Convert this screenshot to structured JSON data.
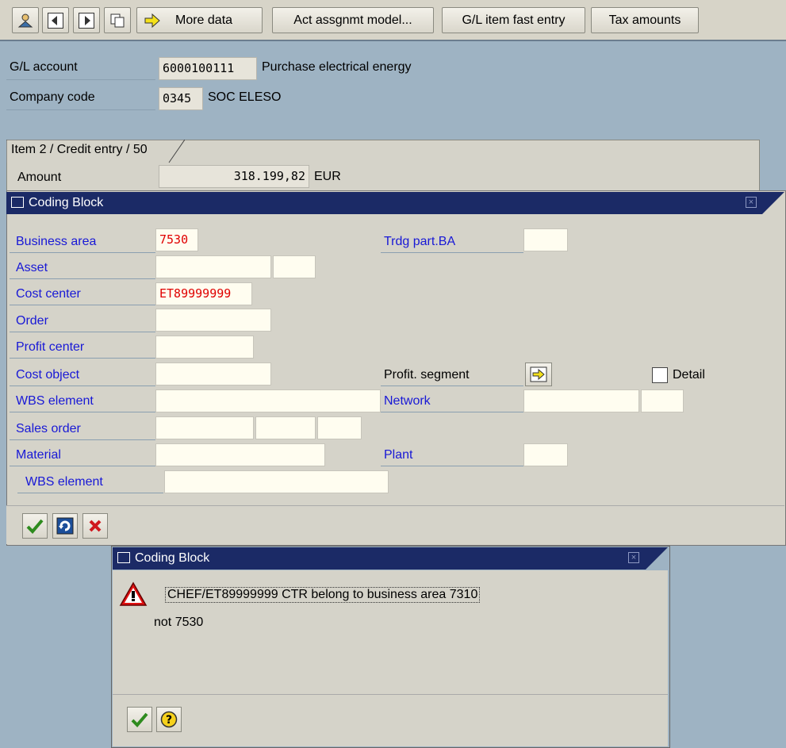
{
  "toolbar": {
    "more_data": "More data",
    "act_assignment_model": "Act assgnmt model...",
    "gl_item_fast_entry": "G/L item fast entry",
    "tax_amounts": "Tax amounts"
  },
  "header": {
    "gl_account_label": "G/L account",
    "gl_account_value": "6000100111",
    "gl_account_desc": "Purchase electrical energy",
    "company_code_label": "Company code",
    "company_code_value": "0345",
    "company_code_desc": "SOC ELESO"
  },
  "item": {
    "tab_label": "Item 2 / Credit entry / 50",
    "amount_label": "Amount",
    "amount_value": "318.199,82",
    "currency": "EUR"
  },
  "coding_block": {
    "title": "Coding Block",
    "business_area_label": "Business area",
    "business_area_value": "7530",
    "trdg_part_ba_label": "Trdg part.BA",
    "trdg_part_ba_value": "",
    "asset_label": "Asset",
    "cost_center_label": "Cost center",
    "cost_center_value": "ET89999999",
    "order_label": "Order",
    "profit_center_label": "Profit center",
    "cost_object_label": "Cost object",
    "profit_segment_label": "Profit. segment",
    "detail_label": "Detail",
    "wbs_element_label": "WBS element",
    "network_label": "Network",
    "sales_order_label": "Sales order",
    "material_label": "Material",
    "plant_label": "Plant",
    "wbs_element2_label": "WBS element"
  },
  "message_dialog": {
    "title": "Coding Block",
    "line1": "CHEF/ET89999999 CTR belong to business area 7310",
    "line2": "not 7530"
  },
  "colors": {
    "background": "#9eb3c3",
    "title_bar": "#1b2a66",
    "error_text": "#e00000",
    "label_blue": "#1818d6"
  }
}
